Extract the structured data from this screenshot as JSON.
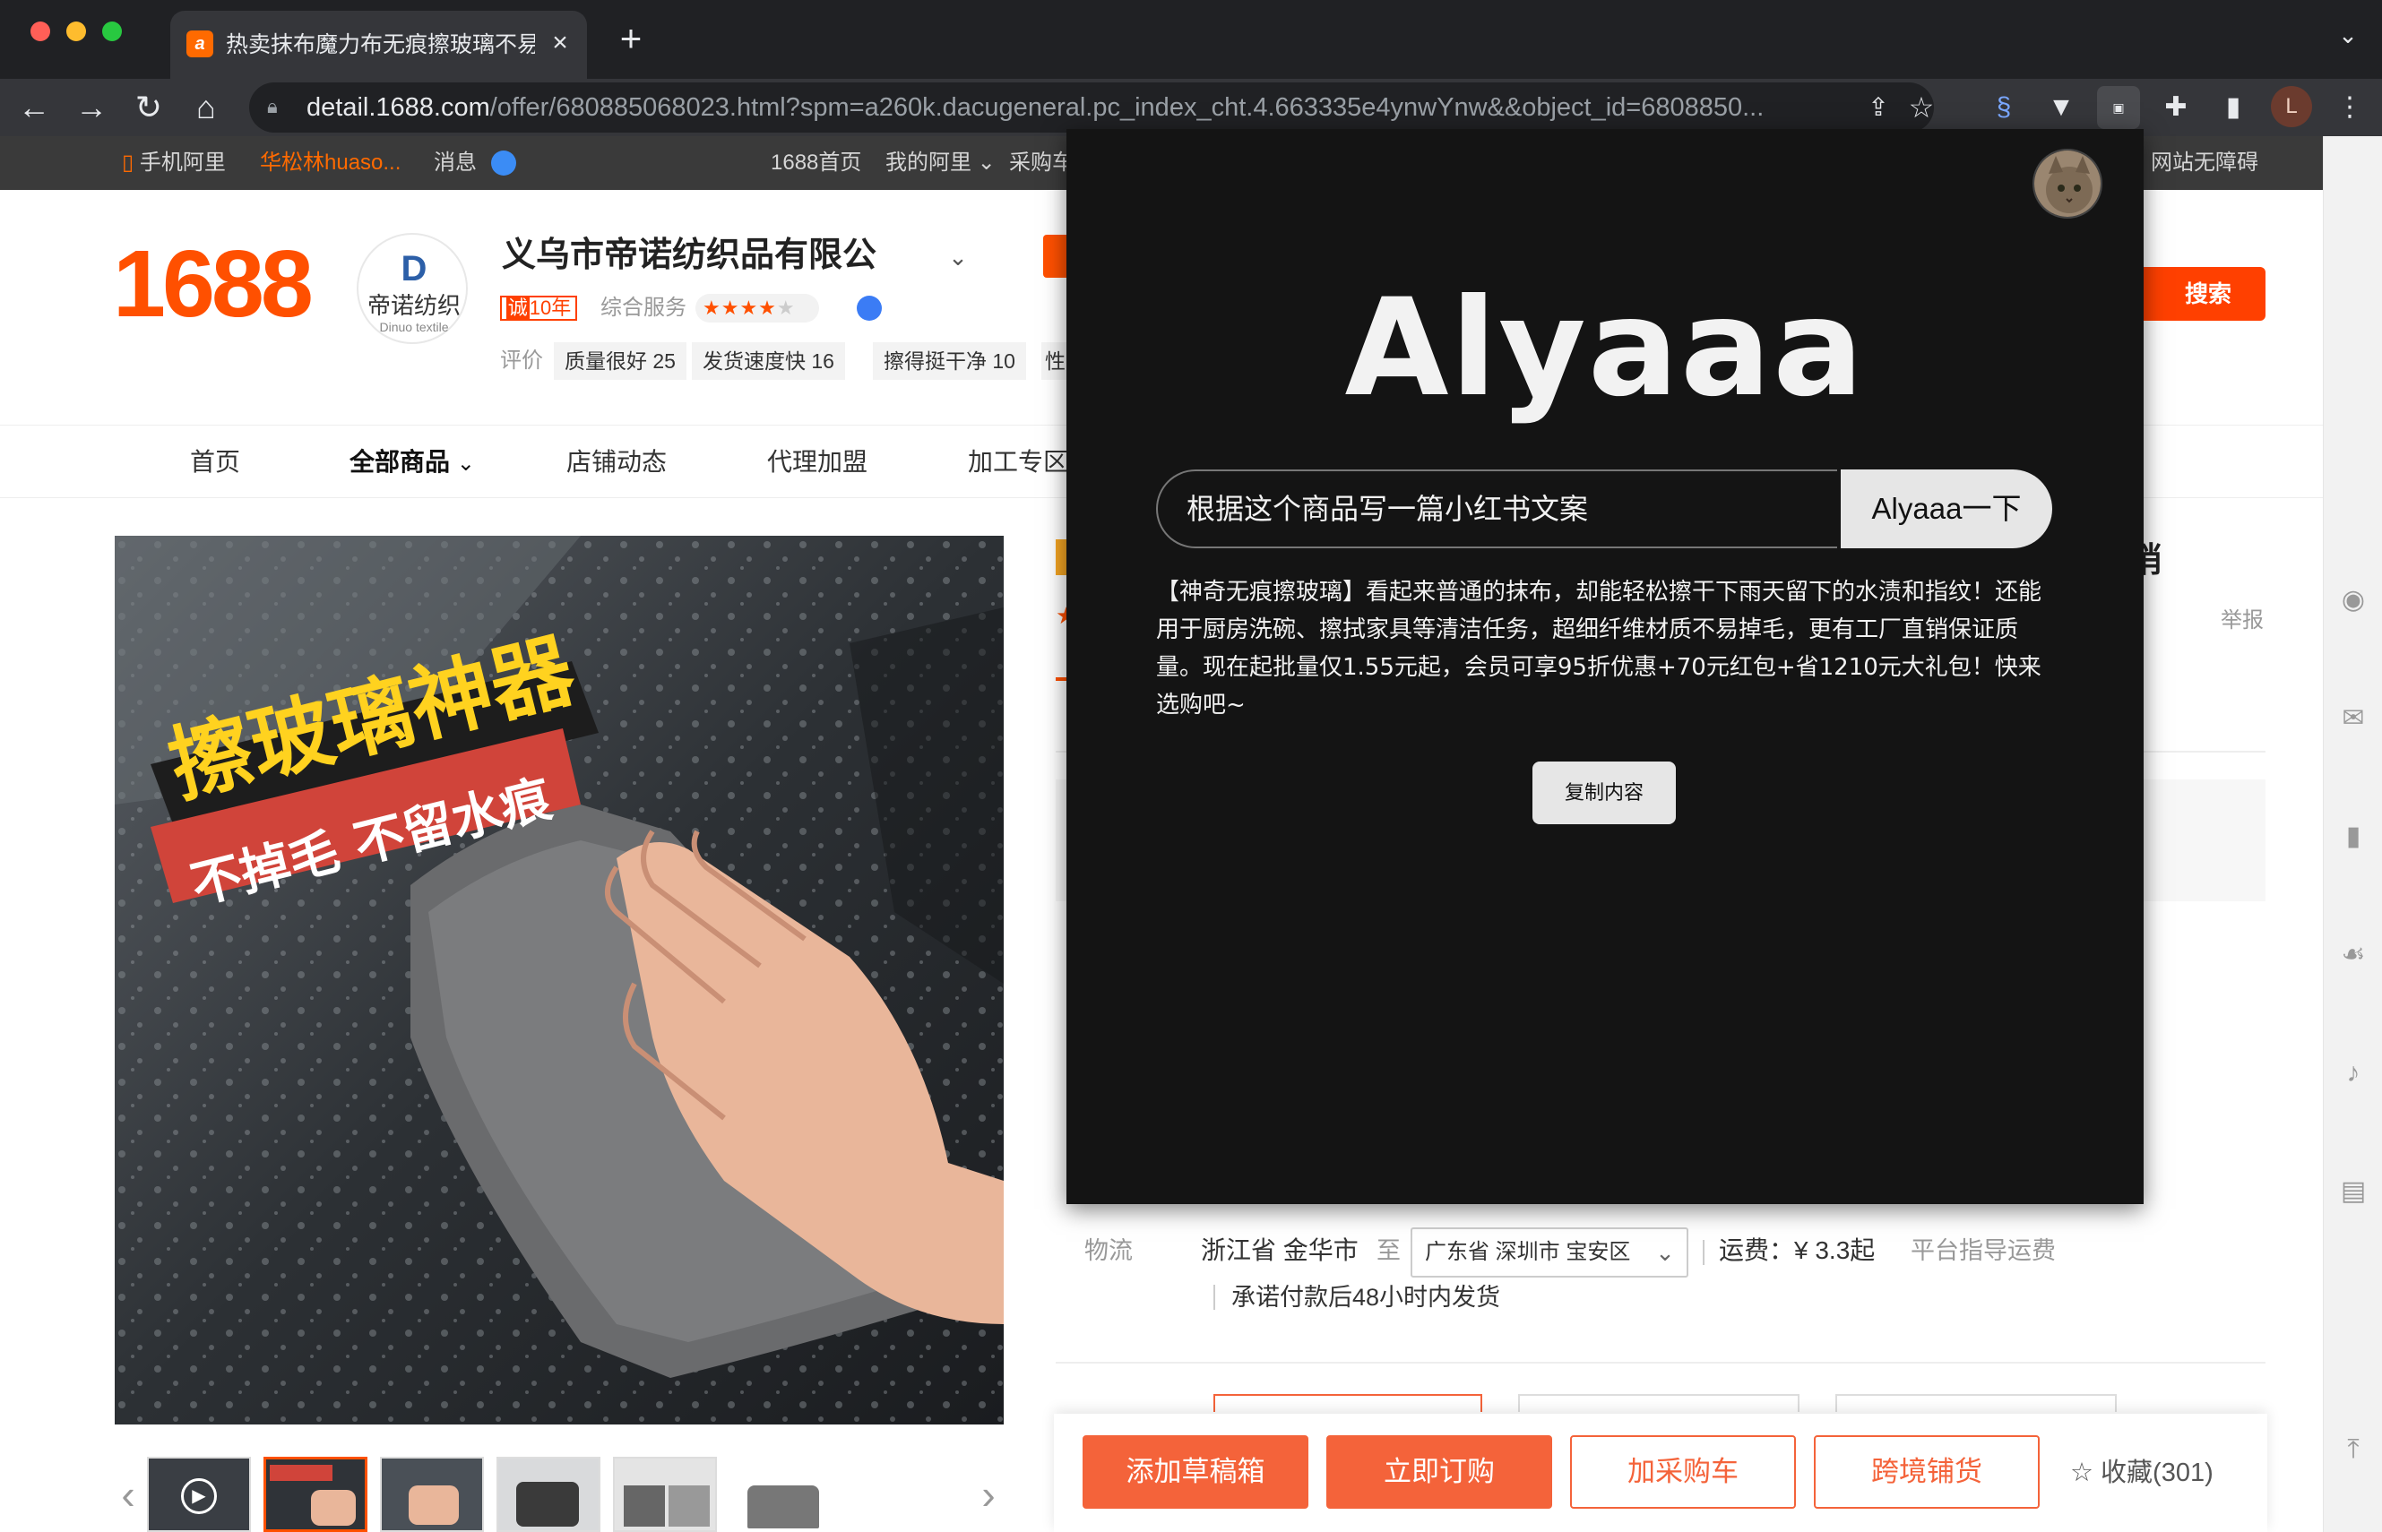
{
  "browser": {
    "tab_title": "热卖抹布魔力布无痕擦玻璃不易掉",
    "tab_close": "×",
    "new_tab": "+",
    "tab_menu": "⌄",
    "url_host": "detail.1688.com",
    "url_path": "/offer/680885068023.html?spm=a260k.dacugeneral.pc_index_cht.4.663335e4ynwYnw&&object_id=6808850...",
    "profile_initial": "L",
    "icons": [
      "back-icon",
      "forward-icon",
      "reload-icon",
      "home-icon",
      "lock-icon",
      "share-icon",
      "star-icon",
      "extension-icon",
      "puzzle-icon",
      "sidepanel-icon",
      "menu-icon"
    ]
  },
  "sitebar": {
    "mobile": "手机阿里",
    "user": "华松林huaso...",
    "messages": "消息",
    "home": "1688首页",
    "my_ali": "我的阿里",
    "cart": "采购车",
    "accessibility": "网站无障碍"
  },
  "shop": {
    "logo": "1688",
    "logo_cn": "帝诺纺织",
    "logo_en": "Dinuo textile",
    "name": "义乌市帝诺纺织品有限公",
    "cheng": "诚",
    "years": "10年",
    "service_label": "综合服务",
    "rating_label": "评价",
    "ratings": [
      "质量很好 25",
      "发货速度快 16",
      "擦得挺干净 10"
    ],
    "rating_cut": "性",
    "search_button": "搜索"
  },
  "shop_nav": {
    "home": "首页",
    "all_products": "全部商品",
    "news": "店铺动态",
    "agency": "代理加盟",
    "processing": "加工专区"
  },
  "product_image": {
    "headline": "擦玻璃神器",
    "subline": "不掉毛 不留水痕"
  },
  "product": {
    "title_end": "销",
    "report": "举报"
  },
  "logistics": {
    "label": "物流",
    "from": "浙江省 金华市",
    "to_label": "至",
    "destination": "广东省 深圳市 宝安区",
    "freight": "运费：¥ 3.3起",
    "freight_guide": "平台指导运费",
    "promise": "承诺付款后48小时内发货"
  },
  "actions": {
    "draft": "添加草稿箱",
    "order": "立即订购",
    "cart": "加采购车",
    "crossborder": "跨境铺货",
    "favorite": "☆ 收藏(301)"
  },
  "popup": {
    "brand": "Alyaaa",
    "prompt": "根据这个商品写一篇小红书文案",
    "ask_button": "Alyaaa一下",
    "answer": "【神奇无痕擦玻璃】看起来普通的抹布，却能轻松擦干下雨天留下的水渍和指纹！还能用于厨房洗碗、擦拭家具等清洁任务，超细纤维材质不易掉毛，更有工厂直销保证质量。现在起批量仅1.55元起，会员可享95折优惠+70元红包+省1210元大礼包！快来选购吧~",
    "copy_button": "复制内容"
  },
  "colors": {
    "brand_orange": "#ff5000",
    "action_orange": "#f4633a",
    "popup_bg": "#141414",
    "chrome_dark": "#202124"
  }
}
